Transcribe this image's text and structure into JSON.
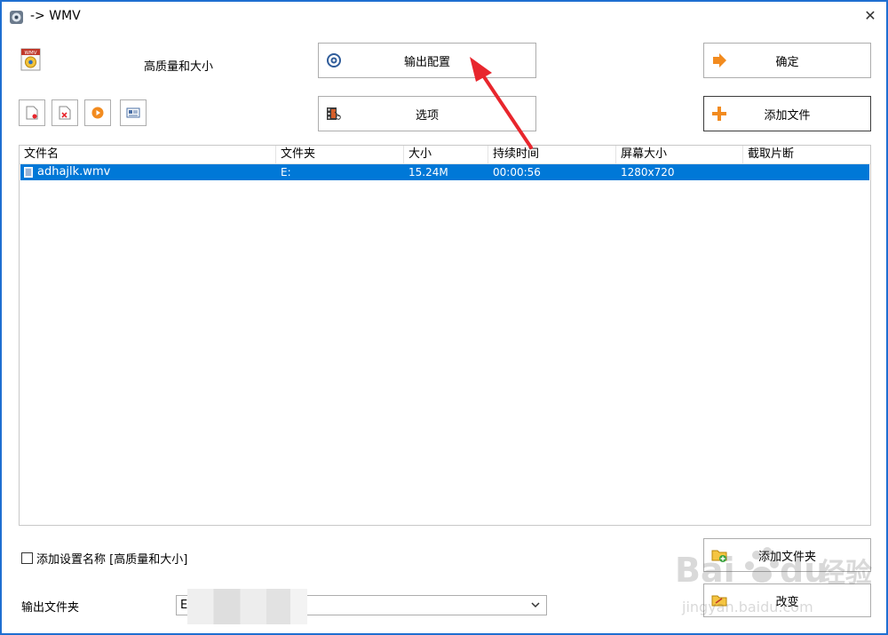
{
  "window": {
    "title": "-> WMV"
  },
  "preset": {
    "name": "高质量和大小",
    "icon_text": "WMV"
  },
  "buttons": {
    "output_config": "输出配置",
    "options": "选项",
    "ok": "确定",
    "add_file": "添加文件",
    "add_folder": "添加文件夹",
    "change": "改变"
  },
  "file_list": {
    "columns": [
      "文件名",
      "文件夹",
      "大小",
      "持续时间",
      "屏幕大小",
      "截取片断"
    ],
    "rows": [
      {
        "name": "adhajlk.wmv",
        "folder": "E:",
        "size": "15.24M",
        "duration": "00:00:56",
        "screen": "1280x720",
        "clip": ""
      }
    ]
  },
  "settings": {
    "add_setting_name_label": "添加设置名称 [高质量和大小]",
    "output_folder_label": "输出文件夹",
    "output_folder_value": "E"
  },
  "watermark": {
    "brand": "Bai",
    "brand2": "du",
    "brand3": "经验",
    "url": "jingyan.baidu.com"
  },
  "colors": {
    "accent": "#0078d7",
    "border": "#1e6fd1",
    "annotation": "#e8262d",
    "orange": "#f28b1f"
  }
}
